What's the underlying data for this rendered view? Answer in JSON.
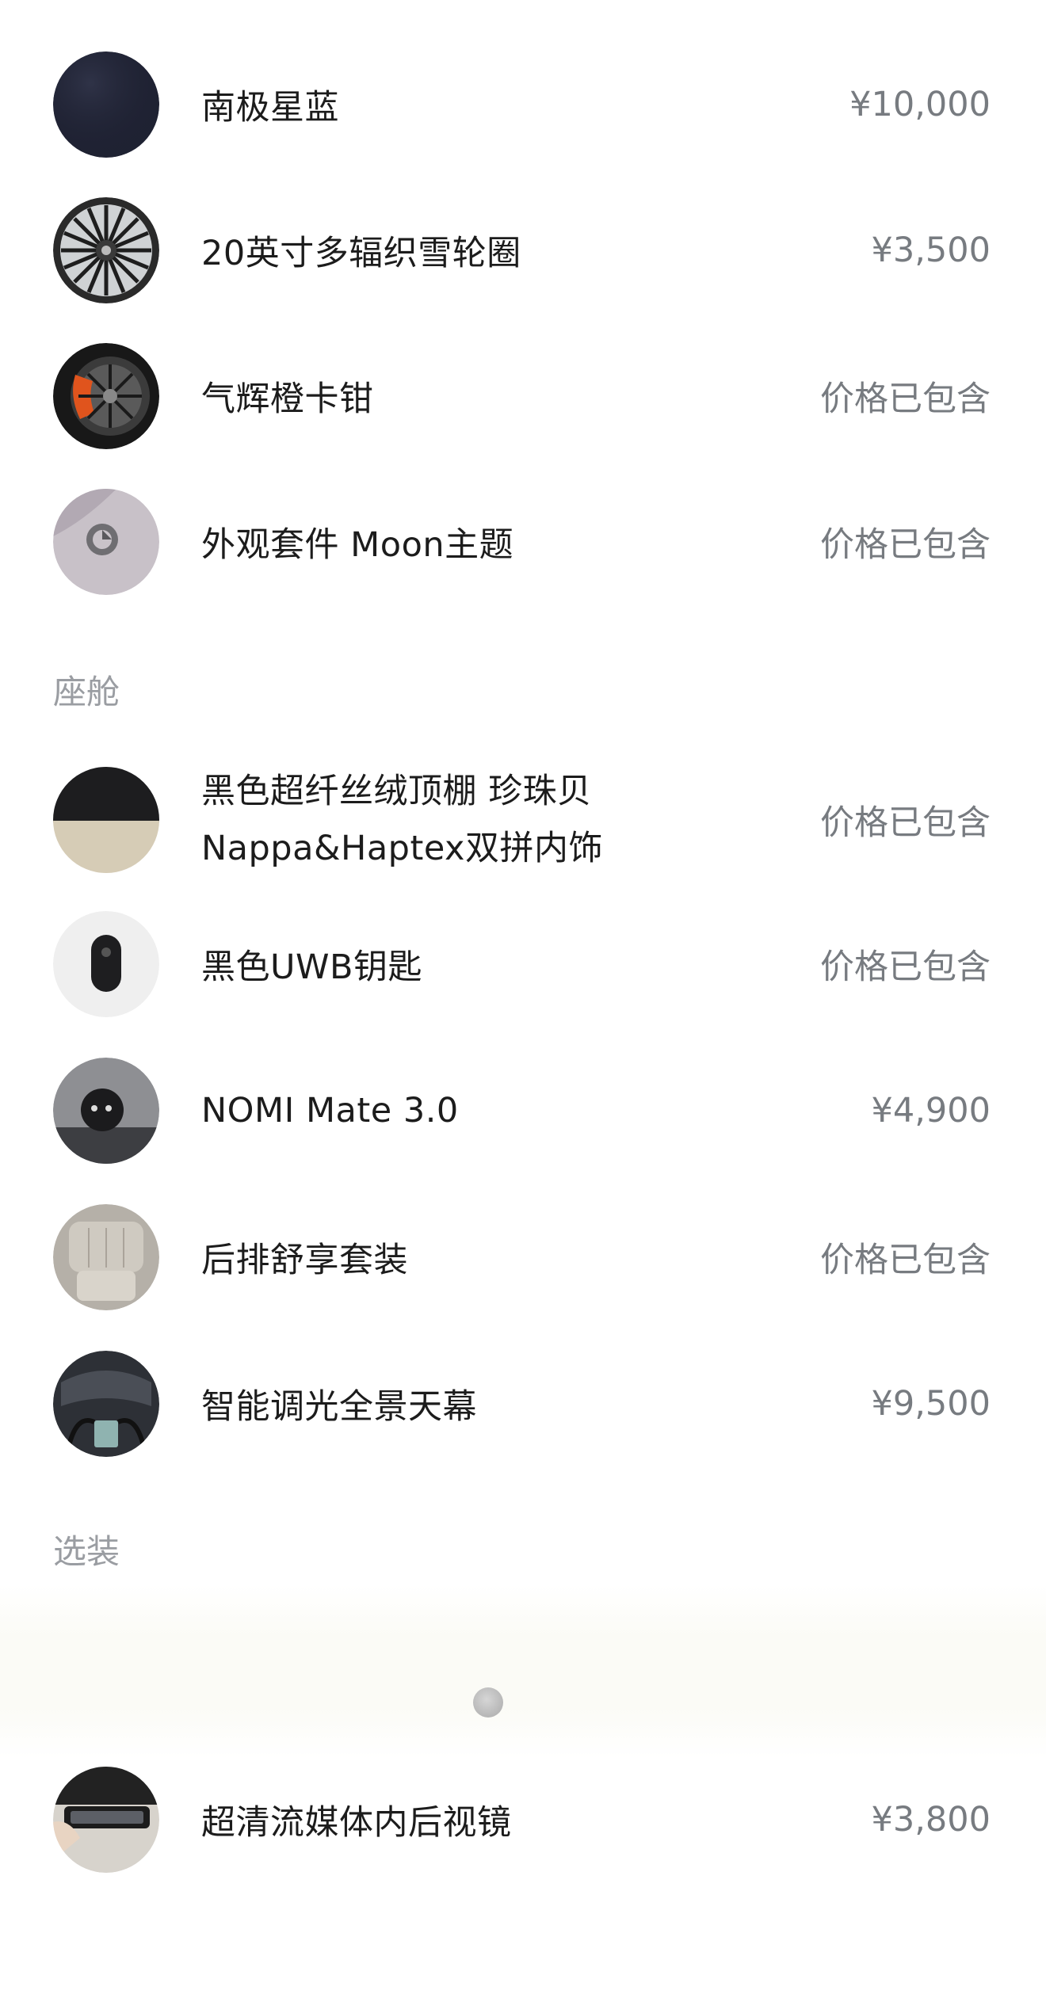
{
  "exterior_items": [
    {
      "name": "南极星蓝",
      "price": "¥10,000",
      "icon": "paint-swatch-icon"
    },
    {
      "name": "20英寸多辐织雪轮圈",
      "price": "¥3,500",
      "icon": "wheel-icon"
    },
    {
      "name": "气辉橙卡钳",
      "price": "价格已包含",
      "icon": "caliper-icon"
    },
    {
      "name": "外观套件 Moon主题",
      "price": "价格已包含",
      "icon": "exterior-kit-icon"
    }
  ],
  "cabin_section_title": "座舱",
  "cabin_items": [
    {
      "name_line1": "黑色超纤丝绒顶棚 珍珠贝",
      "name_line2": "Nappa&Haptex双拼内饰",
      "price": "价格已包含",
      "icon": "interior-swatch-icon"
    },
    {
      "name": "黑色UWB钥匙",
      "price": "价格已包含",
      "icon": "key-fob-icon"
    },
    {
      "name": "NOMI Mate 3.0",
      "price": "¥4,900",
      "icon": "nomi-robot-icon"
    },
    {
      "name": "后排舒享套装",
      "price": "价格已包含",
      "icon": "rear-seat-icon"
    },
    {
      "name": "智能调光全景天幕",
      "price": "¥9,500",
      "icon": "panoramic-roof-icon"
    }
  ],
  "options_section_title": "选装",
  "option_items": [
    {
      "name": "超清流媒体内后视镜",
      "price": "¥3,800",
      "icon": "rearview-mirror-icon"
    }
  ]
}
